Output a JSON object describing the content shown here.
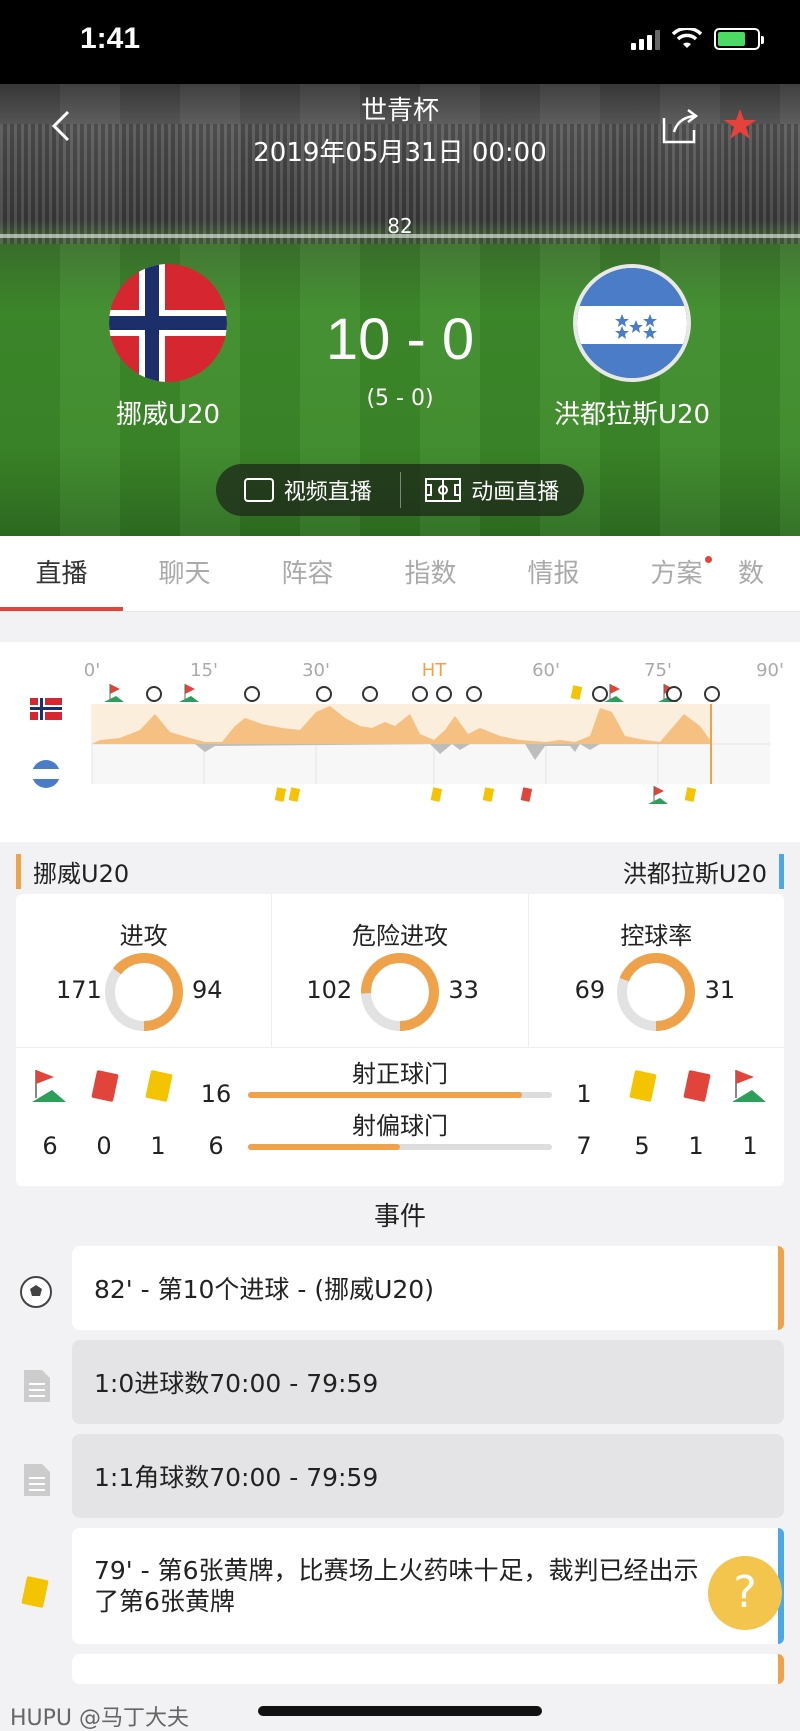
{
  "status_bar": {
    "time": "1:41"
  },
  "header": {
    "competition": "世青杯",
    "datetime": "2019年05月31日 00:00",
    "minute": "82",
    "home_team": "挪威U20",
    "away_team": "洪都拉斯U20",
    "score": "10 - 0",
    "halftime_score": "(5 - 0)",
    "video_live": "视频直播",
    "animation_live": "动画直播"
  },
  "tabs": [
    "直播",
    "聊天",
    "阵容",
    "指数",
    "情报",
    "方案",
    "数"
  ],
  "timeline": {
    "ticks": [
      "0'",
      "15'",
      "30'",
      "HT",
      "60'",
      "75'",
      "90'"
    ],
    "current_minute": 82
  },
  "teams": {
    "home": "挪威U20",
    "away": "洪都拉斯U20"
  },
  "stats": {
    "attack": {
      "label": "进攻",
      "home": 171,
      "away": 94
    },
    "dangerous_attack": {
      "label": "危险进攻",
      "home": 102,
      "away": 33
    },
    "possession": {
      "label": "控球率",
      "home": 69,
      "away": 31
    },
    "shots_on": {
      "label": "射正球门",
      "home": 16,
      "away": 1
    },
    "shots_off": {
      "label": "射偏球门",
      "home": 6,
      "away": 7
    },
    "home_corners": "6",
    "home_red": "0",
    "home_yellow": "1",
    "away_yellow": "5",
    "away_red": "1",
    "away_corners": "1"
  },
  "events_title": "事件",
  "events": [
    {
      "text": "82' - 第10个进球 - (挪威U20)",
      "icon": "ball-icon"
    },
    {
      "text": "1:0进球数70:00 - 79:59",
      "icon": "document-icon"
    },
    {
      "text": "1:1角球数70:00 - 79:59",
      "icon": "document-icon"
    },
    {
      "text": "79' - 第6张黄牌，比赛场上火药味十足，裁判已经出示了第6张黄牌",
      "icon": "yellow-card-icon"
    }
  ],
  "fab": "?",
  "watermark": "HUPU @马丁大夫",
  "colors": {
    "accent": "#e0443b",
    "home": "#f0a24a",
    "away": "#4aa8e8",
    "yellow": "#f4c400",
    "red": "#e0443b"
  }
}
